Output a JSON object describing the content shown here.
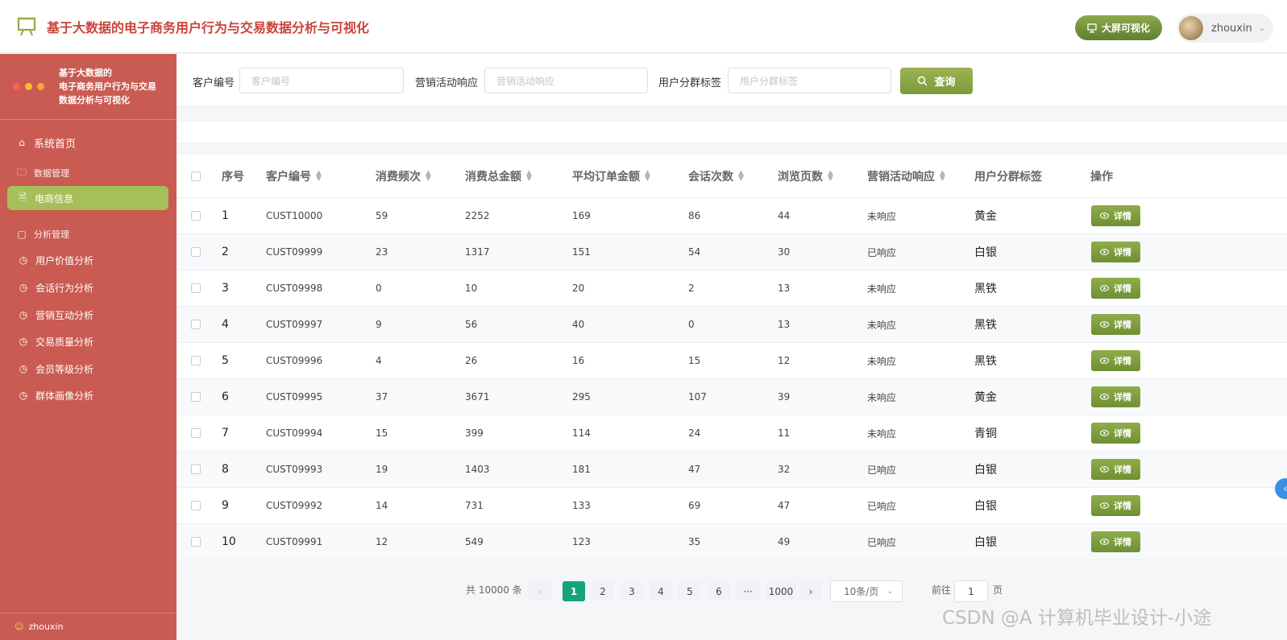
{
  "header": {
    "title": "基于大数据的电子商务用户行为与交易数据分析与可视化",
    "bigscreen_label": "大屏可视化",
    "username": "zhouxin",
    "logo_icon": "presentation-board-icon"
  },
  "sidebar": {
    "title_line1": "基于大数据的",
    "title_line2": "电子商务用户行为与交易",
    "title_line3": "数据分析与可视化",
    "dot_colors": [
      "#ff5f57",
      "#febc2e",
      "#f2a93b"
    ],
    "home": "系统首页",
    "group_data": "数据管理",
    "ecommerce": "电商信息",
    "group_analysis": "分析管理",
    "analysis_items": [
      "用户价值分析",
      "会话行为分析",
      "营销互动分析",
      "交易质量分析",
      "会员等级分析",
      "群体画像分析"
    ],
    "footer_user": "zhouxin"
  },
  "search": {
    "customer_label": "客户编号",
    "customer_placeholder": "客户编号",
    "response_label": "营销活动响应",
    "response_placeholder": "营销活动响应",
    "segment_label": "用户分群标签",
    "segment_placeholder": "用户分群标签",
    "query_label": "查询"
  },
  "table": {
    "headers": [
      "序号",
      "客户编号",
      "消费频次",
      "消费总金额",
      "平均订单金额",
      "会话次数",
      "浏览页数",
      "营销活动响应",
      "用户分群标签",
      "操作"
    ],
    "detail_label": "详情",
    "rows": [
      [
        "1",
        "CUST10000",
        "59",
        "2252",
        "169",
        "86",
        "44",
        "未响应",
        "黄金"
      ],
      [
        "2",
        "CUST09999",
        "23",
        "1317",
        "151",
        "54",
        "30",
        "已响应",
        "白银"
      ],
      [
        "3",
        "CUST09998",
        "0",
        "10",
        "20",
        "2",
        "13",
        "未响应",
        "黑铁"
      ],
      [
        "4",
        "CUST09997",
        "9",
        "56",
        "40",
        "0",
        "13",
        "未响应",
        "黑铁"
      ],
      [
        "5",
        "CUST09996",
        "4",
        "26",
        "16",
        "15",
        "12",
        "未响应",
        "黑铁"
      ],
      [
        "6",
        "CUST09995",
        "37",
        "3671",
        "295",
        "107",
        "39",
        "未响应",
        "黄金"
      ],
      [
        "7",
        "CUST09994",
        "15",
        "399",
        "114",
        "24",
        "11",
        "未响应",
        "青铜"
      ],
      [
        "8",
        "CUST09993",
        "19",
        "1403",
        "181",
        "47",
        "32",
        "已响应",
        "白银"
      ],
      [
        "9",
        "CUST09992",
        "14",
        "731",
        "133",
        "69",
        "47",
        "已响应",
        "白银"
      ],
      [
        "10",
        "CUST09991",
        "12",
        "549",
        "123",
        "35",
        "49",
        "已响应",
        "白银"
      ]
    ]
  },
  "pagination": {
    "total": "共 10000 条",
    "pages": [
      "1",
      "2",
      "3",
      "4",
      "5",
      "6",
      "···",
      "1000"
    ],
    "active_page": "1",
    "page_size": "10条/页",
    "goto_label": "前往",
    "goto_value": "1",
    "page_suffix": "页"
  },
  "watermark": "CSDN @A 计算机毕业设计-小途",
  "colors": {
    "sidebar_bg": "#c95b52",
    "accent_green": "#a6bf59",
    "title_red": "#c9433a",
    "active_page": "#17a37d"
  }
}
